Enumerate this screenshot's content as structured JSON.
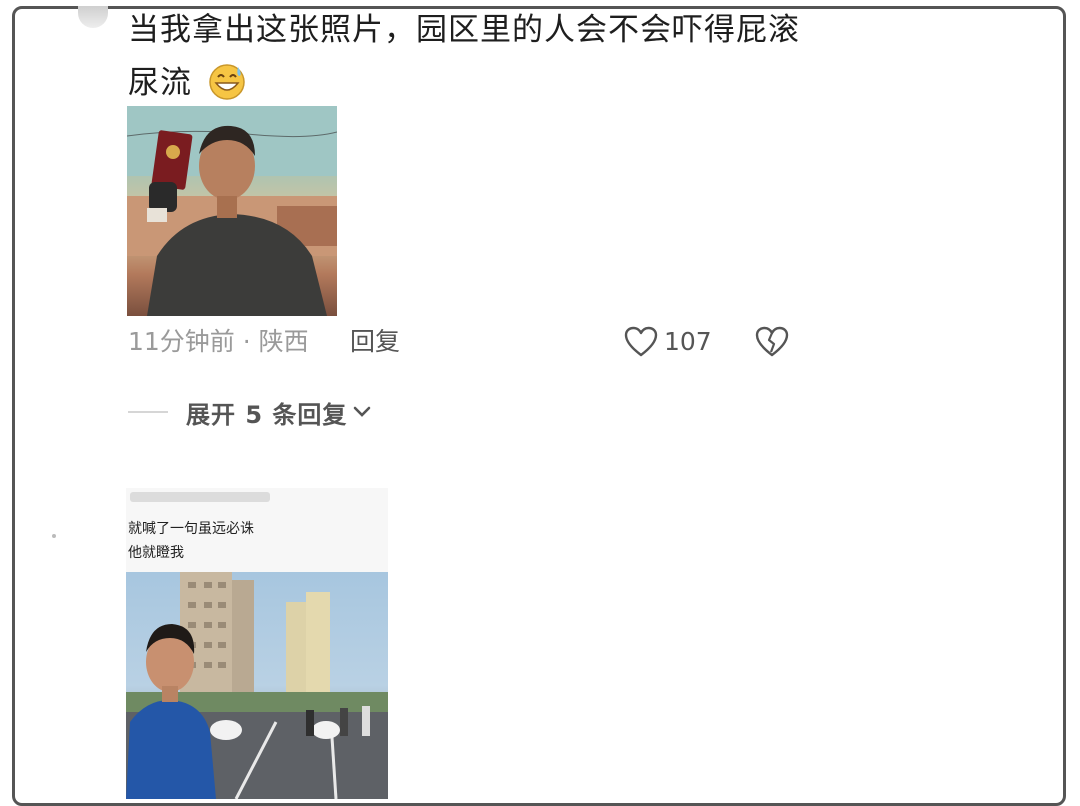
{
  "comment": {
    "text": "当我拿出这张照片，园区里的人会不会吓得屁滚尿流",
    "emoji": "grinning-sweat-emoji"
  },
  "meta": {
    "time_location": "11分钟前 · 陕西",
    "reply_label": "回复",
    "like_count": "107"
  },
  "expand": {
    "label": "展开 5 条回复"
  },
  "second_image": {
    "caption_line1": "就喊了一句虽远必诛",
    "caption_line2": "他就瞪我"
  },
  "colors": {
    "text": "#1e1e1e",
    "meta": "#9a9a9a",
    "frame": "#555555"
  }
}
